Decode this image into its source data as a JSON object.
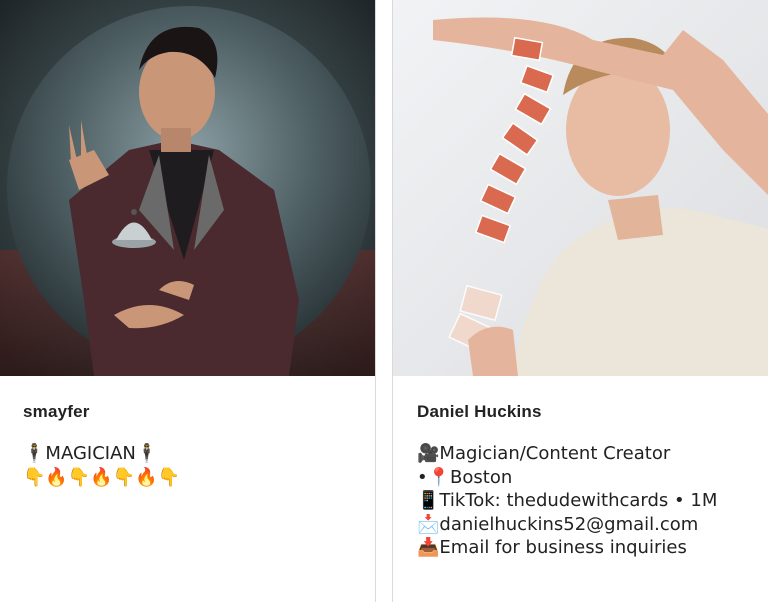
{
  "profiles": [
    {
      "username": "smayfer",
      "bio_lines": [
        "🕴MAGICIAN🕴",
        "👇🔥👇🔥👇🔥👇"
      ]
    },
    {
      "username": "Daniel Huckins",
      "bio_lines": [
        "🎥Magician/Content Creator",
        "•📍Boston",
        "📱TikTok: thedudewithcards • 1M",
        "📩danielhuckins52@gmail.com",
        "📥Email for business inquiries"
      ]
    }
  ],
  "colors": {
    "card_border": "#d9d9d9",
    "text": "#222222",
    "left_photo_bg": "#3a4448",
    "right_photo_bg": "#e9eaec"
  }
}
